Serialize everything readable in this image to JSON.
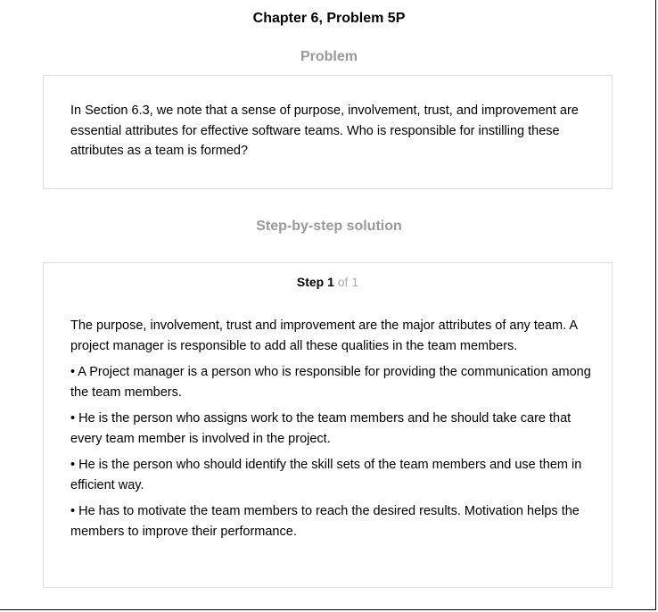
{
  "header": {
    "title": "Chapter 6, Problem 5P"
  },
  "problem": {
    "heading": "Problem",
    "text": "In Section 6.3, we note that a sense of purpose, involvement, trust, and improvement are essential attributes for effective software teams. Who is responsible for instilling these attributes as a team is formed?"
  },
  "solution": {
    "heading": "Step-by-step solution",
    "step": {
      "label": "Step 1",
      "of": "of 1"
    },
    "paragraphs": [
      "The purpose, involvement, trust and improvement are the major attributes of any team. A project manager is responsible to add all these qualities in the team members.",
      "• A Project manager is a person who is responsible for providing the communication among the team members.",
      "• He is the person who assigns work to the team members and he should take care that every team member is involved in the project.",
      "• He is the person who should identify the skill sets of the team members and use them in efficient way.",
      "• He has to motivate the team members to reach the desired results. Motivation helps the members to improve their performance."
    ]
  },
  "colors": {
    "heading_gray": "#999999",
    "card_border": "#dddddd",
    "step_of_gray": "#aaaaaa"
  }
}
